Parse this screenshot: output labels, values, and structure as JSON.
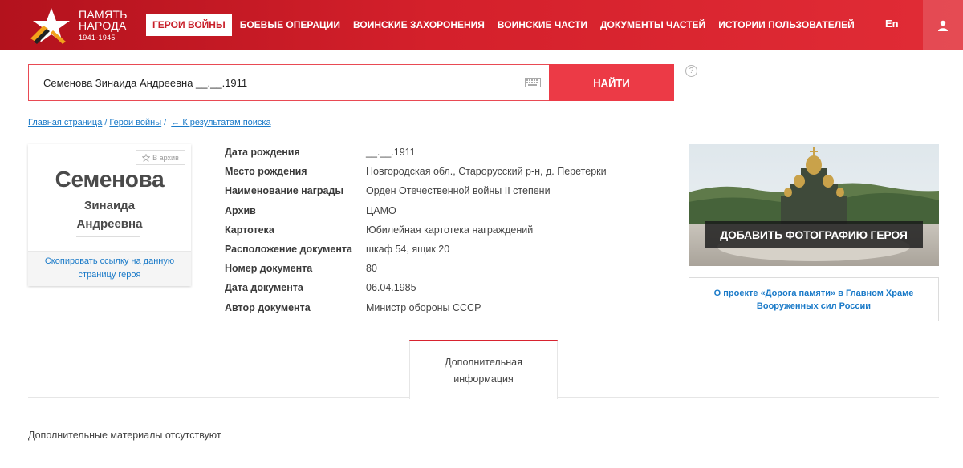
{
  "header": {
    "logo": {
      "line1": "ПАМЯТЬ",
      "line2": "НАРОДА",
      "years": "1941-1945"
    },
    "nav": [
      {
        "label": "ГЕРОИ ВОЙНЫ",
        "active": true
      },
      {
        "label": "БОЕВЫЕ ОПЕРАЦИИ",
        "active": false
      },
      {
        "label": "ВОИНСКИЕ ЗАХОРОНЕНИЯ",
        "active": false
      },
      {
        "label": "ВОИНСКИЕ ЧАСТИ",
        "active": false
      },
      {
        "label": "ДОКУМЕНТЫ ЧАСТЕЙ",
        "active": false
      },
      {
        "label": "ИСТОРИИ ПОЛЬЗОВАТЕЛЕЙ",
        "active": false
      }
    ],
    "lang": "En",
    "user_icon": "user-icon"
  },
  "search": {
    "value": "Семенова Зинаида Андреевна __.__.1911",
    "button": "НАЙТИ",
    "help": "?"
  },
  "breadcrumb": {
    "home": "Главная страница",
    "section": "Герои войны",
    "back": "← К результатам поиска"
  },
  "card": {
    "archive": "В архив",
    "surname": "Семенова",
    "first_name": "Зинаида",
    "patronymic": "Андреевна",
    "copy_link": "Скопировать ссылку на данную страницу героя"
  },
  "details": [
    {
      "label": "Дата рождения",
      "value": "__.__.1911"
    },
    {
      "label": "Место рождения",
      "value": "Новгородская обл., Старорусский р-н, д. Перетерки"
    },
    {
      "label": "Наименование награды",
      "value": "Орден Отечественной войны II степени"
    },
    {
      "label": "Архив",
      "value": "ЦАМО"
    },
    {
      "label": "Картотека",
      "value": "Юбилейная картотека награждений"
    },
    {
      "label": "Расположение документа",
      "value": "шкаф 54, ящик 20"
    },
    {
      "label": "Номер документа",
      "value": "80"
    },
    {
      "label": "Дата документа",
      "value": "06.04.1985"
    },
    {
      "label": "Автор документа",
      "value": "Министр обороны СССР"
    }
  ],
  "banner": {
    "button": "ДОБАВИТЬ ФОТОГРАФИЮ ГЕРОЯ",
    "project": "О проекте «Дорога памяти» в Главном Храме Вооруженных сил России"
  },
  "tab": {
    "line1": "Дополнительная",
    "line2": "информация"
  },
  "no_materials": "Дополнительные материалы отсутствуют",
  "colors": {
    "brand_red": "#d4202b",
    "button_red": "#ec3a46",
    "link_blue": "#1a7ac8"
  }
}
